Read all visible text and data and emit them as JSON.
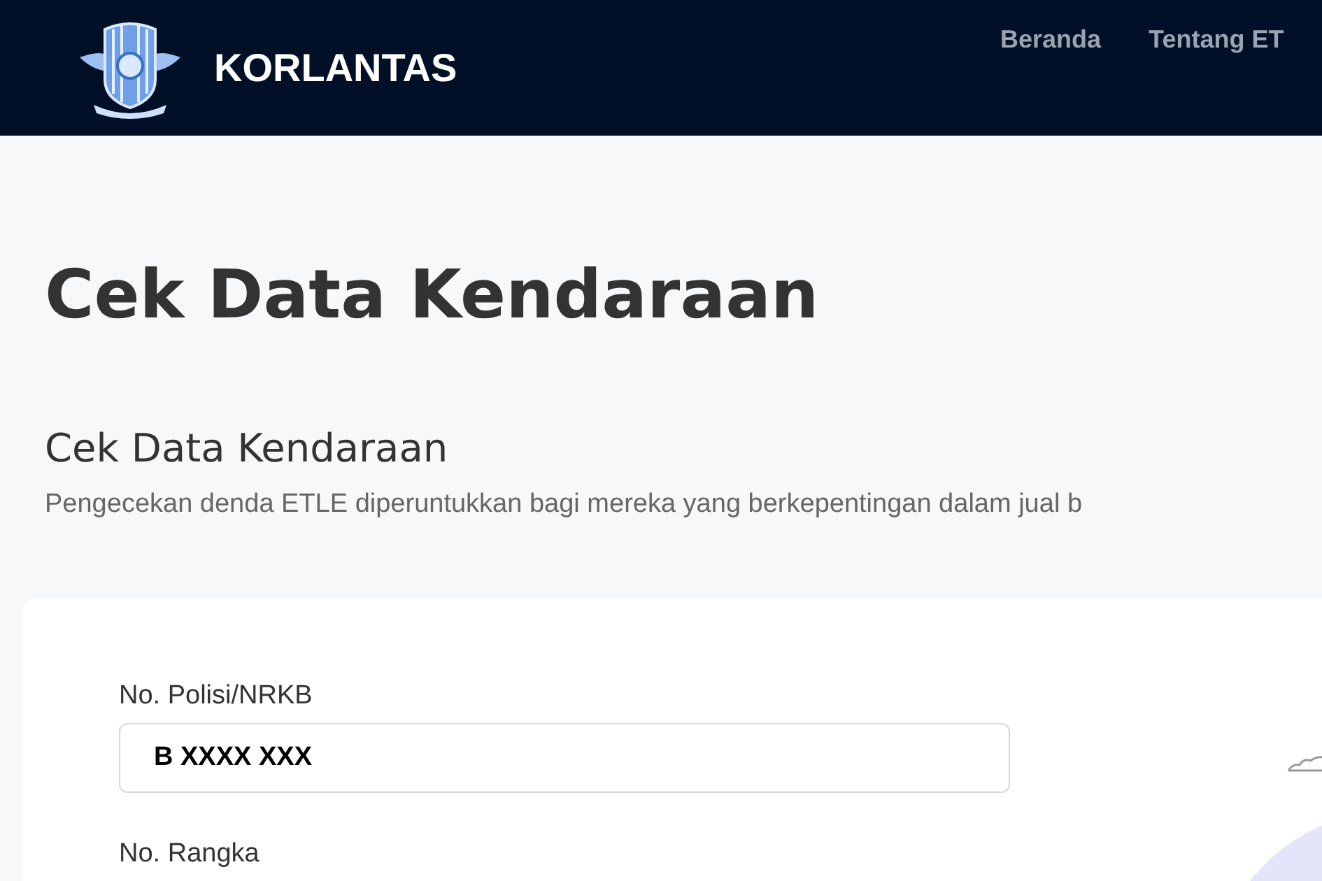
{
  "header": {
    "brand": "KORLANTAS",
    "nav": [
      {
        "label": "Beranda"
      },
      {
        "label": "Tentang ET"
      }
    ]
  },
  "page_title": "Cek Data Kendaraan",
  "section": {
    "title": "Cek Data Kendaraan",
    "description": "Pengecekan denda ETLE diperuntukkan bagi mereka yang berkepentingan dalam jual b"
  },
  "form": {
    "fields": [
      {
        "label": "No. Polisi/NRKB",
        "value": "B XXXX XXX"
      },
      {
        "label": "No. Rangka"
      }
    ]
  }
}
